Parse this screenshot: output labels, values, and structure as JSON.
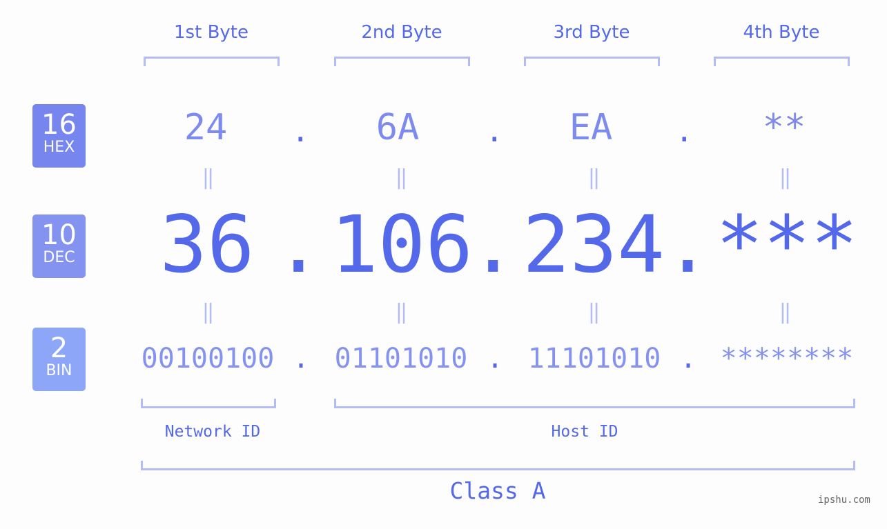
{
  "byte_headers": [
    "1st Byte",
    "2nd Byte",
    "3rd Byte",
    "4th Byte"
  ],
  "badges": [
    {
      "num": "16",
      "label": "HEX",
      "color": "#7686ee"
    },
    {
      "num": "10",
      "label": "DEC",
      "color": "#8493f0"
    },
    {
      "num": "2",
      "label": "BIN",
      "color": "#8ea6f8"
    }
  ],
  "hex": [
    "24",
    "6A",
    "EA",
    "**"
  ],
  "dec": [
    "36",
    "106",
    "234",
    "***"
  ],
  "bin": [
    "00100100",
    "01101010",
    "11101010",
    "********"
  ],
  "separator": ".",
  "equals": "||",
  "network_id_label": "Network ID",
  "host_id_label": "Host ID",
  "class_label": "Class A",
  "watermark": "ipshu.com",
  "colors": {
    "accent": "#5468ea",
    "bracket": "#b3bcf5",
    "background": "#fcfdfc"
  }
}
